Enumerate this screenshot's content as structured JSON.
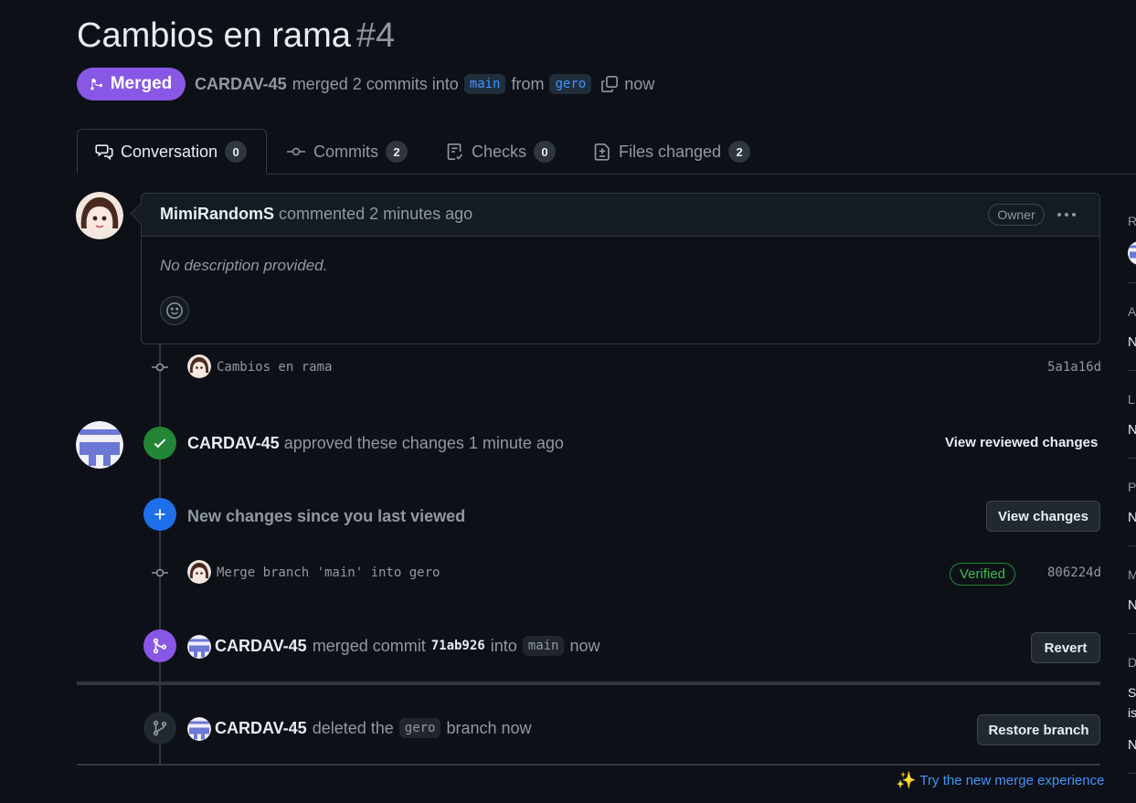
{
  "pr": {
    "title": "Cambios en rama",
    "number": "#4",
    "status": "Merged",
    "author": "CARDAV-45",
    "merge_text": "merged 2 commits into",
    "base_branch": "main",
    "from_text": "from",
    "head_branch": "gero",
    "time": "now"
  },
  "tabs": [
    {
      "label": "Conversation",
      "count": "0"
    },
    {
      "label": "Commits",
      "count": "2"
    },
    {
      "label": "Checks",
      "count": "0"
    },
    {
      "label": "Files changed",
      "count": "2"
    }
  ],
  "comment": {
    "author": "MimiRandomS",
    "action": "commented 2 minutes ago",
    "role": "Owner",
    "body": "No description provided."
  },
  "timeline": {
    "commit1": {
      "message": "Cambios en rama",
      "sha": "5a1a16d"
    },
    "approval": {
      "author": "CARDAV-45",
      "text": "approved these changes 1 minute ago",
      "button": "View reviewed changes"
    },
    "new_changes": {
      "text": "New changes since you last viewed",
      "button": "View changes"
    },
    "commit2": {
      "message": "Merge branch 'main' into gero",
      "badge": "Verified",
      "sha": "806224d"
    },
    "merged": {
      "author": "CARDAV-45",
      "text1": "merged commit",
      "sha": "71ab926",
      "text2": "into",
      "branch": "main",
      "time": "now",
      "button": "Revert"
    },
    "deleted": {
      "author": "CARDAV-45",
      "text1": "deleted the",
      "branch": "gero",
      "text2": "branch now",
      "button": "Restore branch"
    }
  },
  "footer": {
    "link": "Try the new merge experience"
  },
  "sidebar_fragments": {
    "letters": [
      "R",
      "A",
      "L",
      "P",
      "M",
      "D"
    ],
    "values": [
      "N",
      "N",
      "N",
      "N",
      "N"
    ],
    "d_lines": [
      "S",
      "is"
    ],
    "d_value": "N"
  },
  "colors": {
    "background": "#0d1117",
    "merged_purple": "#8957e5",
    "approved_green": "#238636",
    "info_blue": "#1f6feb",
    "link_blue": "#4493f8"
  },
  "icons": [
    "merge-icon",
    "copy-icon",
    "comment-icon",
    "commit-icon",
    "checks-icon",
    "file-diff-icon",
    "kebab-icon",
    "smiley-icon",
    "check-icon",
    "plus-icon",
    "branch-icon",
    "sparkles-icon"
  ]
}
